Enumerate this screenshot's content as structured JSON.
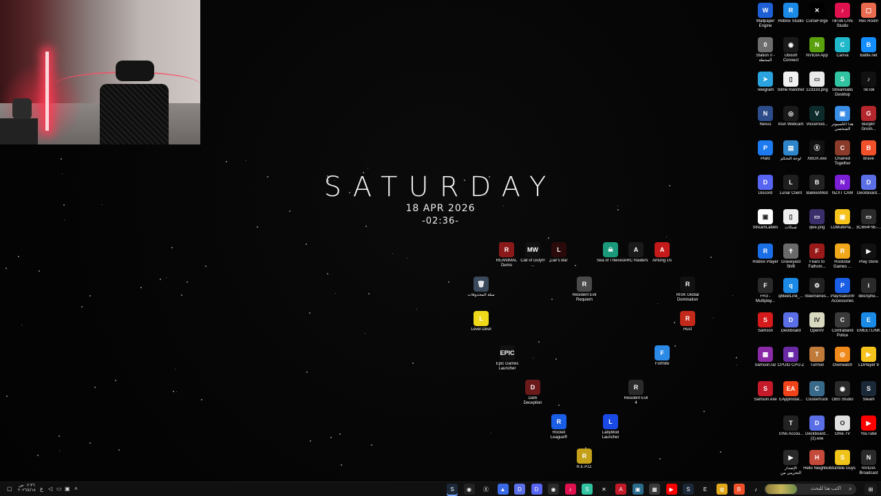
{
  "clock": {
    "day": "SATURDAY",
    "date": "18 APR 2026",
    "time": "-02:36-"
  },
  "desktop_icons": [
    {
      "label": "Wallpaper Engine",
      "color": "#1e5fd6",
      "glyph": "W"
    },
    {
      "label": "Roblox Studio",
      "color": "#1a8ae6",
      "glyph": "R"
    },
    {
      "label": "CurseForge",
      "color": "#000000",
      "glyph": "✕"
    },
    {
      "label": "TikTok LIVE Studio",
      "color": "#e0114f",
      "glyph": "♪"
    },
    {
      "label": "Rec Room",
      "color": "#e86a4f",
      "glyph": "▢"
    },
    {
      "label": "Station 0 - المحطة",
      "color": "#6d6d6d",
      "glyph": "0"
    },
    {
      "label": "Ubisoft Connect",
      "color": "#1a1a1a",
      "glyph": "◉"
    },
    {
      "label": "NVIDIA App",
      "color": "#5aa10d",
      "glyph": "N"
    },
    {
      "label": "Canva",
      "color": "#20b9cc",
      "glyph": "C"
    },
    {
      "label": "Battle.net",
      "color": "#148eff",
      "glyph": "B"
    },
    {
      "label": "Telegram",
      "color": "#2aa3de",
      "glyph": "➤"
    },
    {
      "label": "Slime Rancher",
      "color": "#f1f1f1",
      "glyph": "▯"
    },
    {
      "label": "123333.png",
      "color": "#e9e9e9",
      "glyph": "▭"
    },
    {
      "label": "Streamlabs Desktop",
      "color": "#31c3a2",
      "glyph": "S"
    },
    {
      "label": "TikTok",
      "color": "#111111",
      "glyph": "♪"
    },
    {
      "label": "Nexus",
      "color": "#2d4d8a",
      "glyph": "N"
    },
    {
      "label": "Iriun Webcam",
      "color": "#1a1a1a",
      "glyph": "◎"
    },
    {
      "label": "Voicemod...",
      "color": "#0d2b2b",
      "glyph": "V"
    },
    {
      "label": "هذا الكمبيوتر الشخصي",
      "color": "#3a8ee6",
      "glyph": "▣"
    },
    {
      "label": "Burglin' Gnom...",
      "color": "#b3262c",
      "glyph": "G"
    },
    {
      "label": "Plato",
      "color": "#1d7af0",
      "glyph": "P"
    },
    {
      "label": "لوحة التحكم",
      "color": "#2f85c9",
      "glyph": "▤"
    },
    {
      "label": "XBOX.exe",
      "color": "#111111",
      "glyph": "Ⓧ"
    },
    {
      "label": "Chained Together",
      "color": "#8a3b2a",
      "glyph": "C"
    },
    {
      "label": "Brave",
      "color": "#f0512b",
      "glyph": "B"
    },
    {
      "label": "Discord",
      "color": "#5865f2",
      "glyph": "D"
    },
    {
      "label": "Lunar Client",
      "color": "#1e1e1e",
      "glyph": "L"
    },
    {
      "label": "BakkesMod",
      "color": "#222222",
      "glyph": "B"
    },
    {
      "label": "NZXT CAM",
      "color": "#7a1fd6",
      "glyph": "N"
    },
    {
      "label": "Deckboard...",
      "color": "#5a6ee6",
      "glyph": "D"
    },
    {
      "label": "StreamLabels",
      "color": "#ffffff",
      "glyph": "▣"
    },
    {
      "label": "شبكات",
      "color": "#eeeeee",
      "glyph": "▯"
    },
    {
      "label": "qwe.png",
      "color": "#3a2f6a",
      "glyph": "▭"
    },
    {
      "label": "LDMultiPla...",
      "color": "#f5c31c",
      "glyph": "▣"
    },
    {
      "label": "3CB64F9E-...",
      "color": "#2a2a2a",
      "glyph": "▭"
    },
    {
      "label": "Roblox Player",
      "color": "#1a6ee6",
      "glyph": "R"
    },
    {
      "label": "Graveyard Shift",
      "color": "#6a6a6a",
      "glyph": "✝"
    },
    {
      "label": "Fears to Fathom...",
      "color": "#9a1a1a",
      "glyph": "F"
    },
    {
      "label": "Rockstar Games ...",
      "color": "#f0a81a",
      "glyph": "R"
    },
    {
      "label": "Play Store",
      "color": "#111111",
      "glyph": "▶"
    },
    {
      "label": "FR3 - Multiplay...",
      "color": "#2a2a2a",
      "glyph": "F"
    },
    {
      "label": "qMeetLink_...",
      "color": "#1a8ae6",
      "glyph": "q"
    },
    {
      "label": "SteelSeries...",
      "color": "#222222",
      "glyph": "⚙"
    },
    {
      "label": "PlayStation® Accessories",
      "color": "#1a5ee6",
      "glyph": "P"
    },
    {
      "label": "iblisSphe...",
      "color": "#2a2a2a",
      "glyph": "i"
    },
    {
      "label": "Samson",
      "color": "#d41a1a",
      "glyph": "S"
    },
    {
      "label": "Deckboard",
      "color": "#5a6ee6",
      "glyph": "D"
    },
    {
      "label": "OpenIV",
      "color": "#d8d8c0",
      "glyph": "IV"
    },
    {
      "label": "Contraband Police",
      "color": "#3a3a3a",
      "glyph": "C"
    },
    {
      "label": "EMEETLINK",
      "color": "#1a8ae6",
      "glyph": "E"
    },
    {
      "label": "Samson.rar",
      "color": "#8a2aa6",
      "glyph": "▦"
    },
    {
      "label": "CPUID CPU-Z",
      "color": "#6a2aa6",
      "glyph": "▦"
    },
    {
      "label": "Turmoil",
      "color": "#c07a3a",
      "glyph": "T"
    },
    {
      "label": "Overwatch",
      "color": "#f08a1a",
      "glyph": "◎"
    },
    {
      "label": "LDPlayer 9",
      "color": "#f5c31c",
      "glyph": "▶"
    },
    {
      "label": "Samson.exe",
      "color": "#c41a2a",
      "glyph": "S"
    },
    {
      "label": "EAppInstal...",
      "color": "#f0431a",
      "glyph": "EA"
    },
    {
      "label": "Clustertruck",
      "color": "#3a6a8a",
      "glyph": "C"
    },
    {
      "label": "OBS Studio",
      "color": "#2a2a2a",
      "glyph": "◉"
    },
    {
      "label": "Steam",
      "color": "#1b2838",
      "glyph": "S"
    },
    {
      "label": "TcNo Accou...",
      "color": "#222222",
      "glyph": "T"
    },
    {
      "label": "Deckboard... (1).exe",
      "color": "#5a6ee6",
      "glyph": "D"
    },
    {
      "label": "Ome.TV",
      "color": "#e0e0e0",
      "glyph": "O"
    },
    {
      "label": "YouTube",
      "color": "#ff0000",
      "glyph": "▶"
    },
    {
      "label": "الإصدار التجريبي من",
      "color": "#2a2a2a",
      "glyph": "▶"
    },
    {
      "label": "Hello Neighbor",
      "color": "#c44a3a",
      "glyph": "H"
    },
    {
      "label": "Stumble Guys",
      "color": "#f0c31a",
      "glyph": "S"
    },
    {
      "label": "NVIDIA Broadcast",
      "color": "#2a2a2a",
      "glyph": "N"
    },
    {
      "label": "REANIMAL Demo",
      "color": "#8a1a1a",
      "glyph": "R"
    },
    {
      "label": "Call of Duty® ...",
      "color": "#111111",
      "glyph": "MW"
    },
    {
      "label": "Liar's Bar",
      "color": "#2a0a0a",
      "glyph": "L"
    },
    {
      "label": "Sea of Thieves",
      "color": "#1a9a7a",
      "glyph": "☠"
    },
    {
      "label": "ARC Raiders",
      "color": "#1a1a1a",
      "glyph": "A"
    },
    {
      "label": "Among Us",
      "color": "#c41a1a",
      "glyph": "A"
    },
    {
      "label": "سلة المحذوفات",
      "color": "#3a4a5a",
      "glyph": "🗑"
    },
    {
      "label": "Resident Evil Requiem",
      "color": "#4a4a4a",
      "glyph": "R"
    },
    {
      "label": "RISK Global Domination",
      "color": "#111111",
      "glyph": "R"
    },
    {
      "label": "Level Devil",
      "color": "#f0d81a",
      "glyph": "L"
    },
    {
      "label": "Rust",
      "color": "#c42a1a",
      "glyph": "R"
    },
    {
      "label": "Epic Games Launcher",
      "color": "#111111",
      "glyph": "EPIC"
    },
    {
      "label": "Fortnite",
      "color": "#2a8ae6",
      "glyph": "F"
    },
    {
      "label": "Dark Deception",
      "color": "#6a1a1a",
      "glyph": "D"
    },
    {
      "label": "Resident Evil 4",
      "color": "#2a2a2a",
      "glyph": "R"
    },
    {
      "label": "Rocket League®",
      "color": "#1a5ee6",
      "glyph": "R"
    },
    {
      "label": "LabyMod Launcher",
      "color": "#1a4ae6",
      "glyph": "L"
    },
    {
      "label": "R.E.P.O.",
      "color": "#c4a01a",
      "glyph": "R"
    }
  ],
  "taskbar": {
    "search_placeholder": "اكتب هنا للبحث",
    "clock_time": "٠٢:٣٦ ص",
    "clock_date": "٢٠٢٦/٤/١٨",
    "apps": [
      {
        "name": "steam-taskbar-icon",
        "color": "#1b2838",
        "glyph": "S"
      },
      {
        "name": "app-circle-icon",
        "color": "#222222",
        "glyph": "◉"
      },
      {
        "name": "xbox-taskbar-icon",
        "color": "#111111",
        "glyph": "Ⓧ"
      },
      {
        "name": "fox-taskbar-icon",
        "color": "#3a6ae6",
        "glyph": "▲"
      },
      {
        "name": "deckboard-taskbar-icon",
        "color": "#5a6ee6",
        "glyph": "D"
      },
      {
        "name": "discord-taskbar-icon",
        "color": "#5865f2",
        "glyph": "D"
      },
      {
        "name": "obs-taskbar-icon",
        "color": "#2a2a2a",
        "glyph": "◉"
      },
      {
        "name": "tiktok-taskbar-icon",
        "color": "#e0114f",
        "glyph": "♪"
      },
      {
        "name": "streamlabs-taskbar-icon",
        "color": "#31c3a2",
        "glyph": "S"
      },
      {
        "name": "curseforge-taskbar-icon",
        "color": "#111111",
        "glyph": "✕"
      },
      {
        "name": "app-a-taskbar-icon",
        "color": "#c41a2a",
        "glyph": "A"
      },
      {
        "name": "app-b-taskbar-icon",
        "color": "#2a6a8a",
        "glyph": "▣"
      },
      {
        "name": "app-c-taskbar-icon",
        "color": "#3a3a3a",
        "glyph": "▦"
      },
      {
        "name": "youtube-taskbar-icon",
        "color": "#ff0000",
        "glyph": "▶"
      },
      {
        "name": "steam2-taskbar-icon",
        "color": "#1b2838",
        "glyph": "S"
      },
      {
        "name": "epic-taskbar-icon",
        "color": "#111111",
        "glyph": "E"
      },
      {
        "name": "chrome-taskbar-icon",
        "color": "#e0a81a",
        "glyph": "◍"
      },
      {
        "name": "brave-taskbar-icon",
        "color": "#f0512b",
        "glyph": "B"
      },
      {
        "name": "tiktok2-taskbar-icon",
        "color": "#111111",
        "glyph": "♪"
      },
      {
        "name": "folder-taskbar-icon",
        "color": "#e0b81a",
        "glyph": "▭"
      },
      {
        "name": "settings-taskbar-icon",
        "color": "#111111",
        "glyph": "⚙"
      }
    ]
  }
}
